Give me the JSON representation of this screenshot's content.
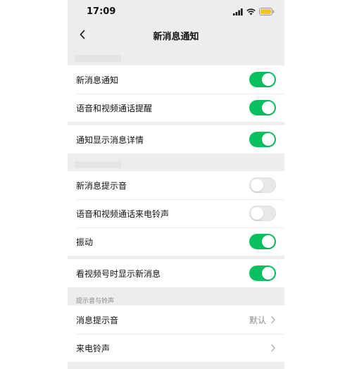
{
  "status_bar": {
    "time": "17:09",
    "icons": [
      "signal-icon",
      "wifi-icon",
      "battery-icon"
    ],
    "battery_color": "#f5c518"
  },
  "nav": {
    "title": "新消息通知",
    "back_icon": "chevron-left-icon"
  },
  "group1": [
    {
      "label": "新消息通知",
      "on": true
    },
    {
      "label": "语音和视频通话提醒",
      "on": true
    }
  ],
  "group2": [
    {
      "label": "通知显示消息详情",
      "on": true
    }
  ],
  "group3": [
    {
      "label": "新消息提示音",
      "on": false
    },
    {
      "label": "语音和视频通话来电铃声",
      "on": false
    },
    {
      "label": "振动",
      "on": true
    }
  ],
  "group4": [
    {
      "label": "看视频号时显示新消息",
      "on": true
    }
  ],
  "sound_section": {
    "title": "提示音与铃声",
    "items": [
      {
        "label": "消息提示音",
        "value": "默认"
      },
      {
        "label": "来电铃声",
        "value": ""
      }
    ]
  },
  "colors": {
    "accent_green": "#07c160",
    "background": "#ededed"
  }
}
